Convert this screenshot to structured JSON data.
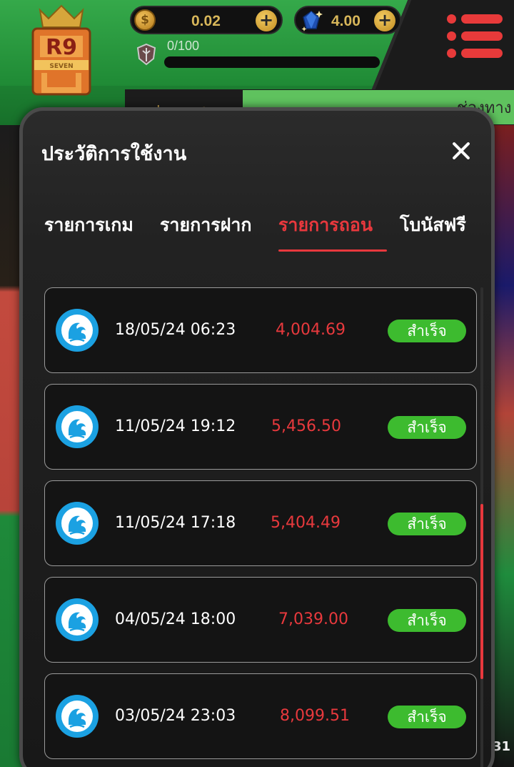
{
  "header": {
    "logo_text_top": "R9",
    "logo_text_mid": "SEVEN",
    "coin_balance": "0.02",
    "gem_balance": "4.00",
    "rank_progress_text": "0/100",
    "rank_progress_fraction": 0,
    "coin_symbol": "$",
    "add_symbol": "+",
    "background_tab_left": "ประกาศ",
    "background_tab_right": "ช่องทาง",
    "side_badge": "31"
  },
  "modal": {
    "title": "ประวัติการใช้งาน",
    "tabs": [
      {
        "label": "รายการเกม",
        "active": false
      },
      {
        "label": "รายการฝาก",
        "active": false
      },
      {
        "label": "รายการถอน",
        "active": true
      },
      {
        "label": "โบนัสฟรี",
        "active": false
      }
    ],
    "transactions": [
      {
        "datetime": "18/05/24 06:23",
        "amount": "4,004.69",
        "status": "สำเร็จ"
      },
      {
        "datetime": "11/05/24 19:12",
        "amount": "5,456.50",
        "status": "สำเร็จ"
      },
      {
        "datetime": "11/05/24 17:18",
        "amount": "5,404.49",
        "status": "สำเร็จ"
      },
      {
        "datetime": "04/05/24 18:00",
        "amount": "7,039.00",
        "status": "สำเร็จ"
      },
      {
        "datetime": "03/05/24 23:03",
        "amount": "8,099.51",
        "status": "สำเร็จ"
      }
    ]
  },
  "colors": {
    "accent_red": "#e8383d",
    "success_green": "#3dbb2f",
    "bank_blue": "#1ba1e2",
    "header_green": "#2d9a3f"
  },
  "icons": {
    "bank": "kasikorn-bank-icon",
    "close": "close-icon",
    "menu": "hamburger-menu-icon"
  }
}
